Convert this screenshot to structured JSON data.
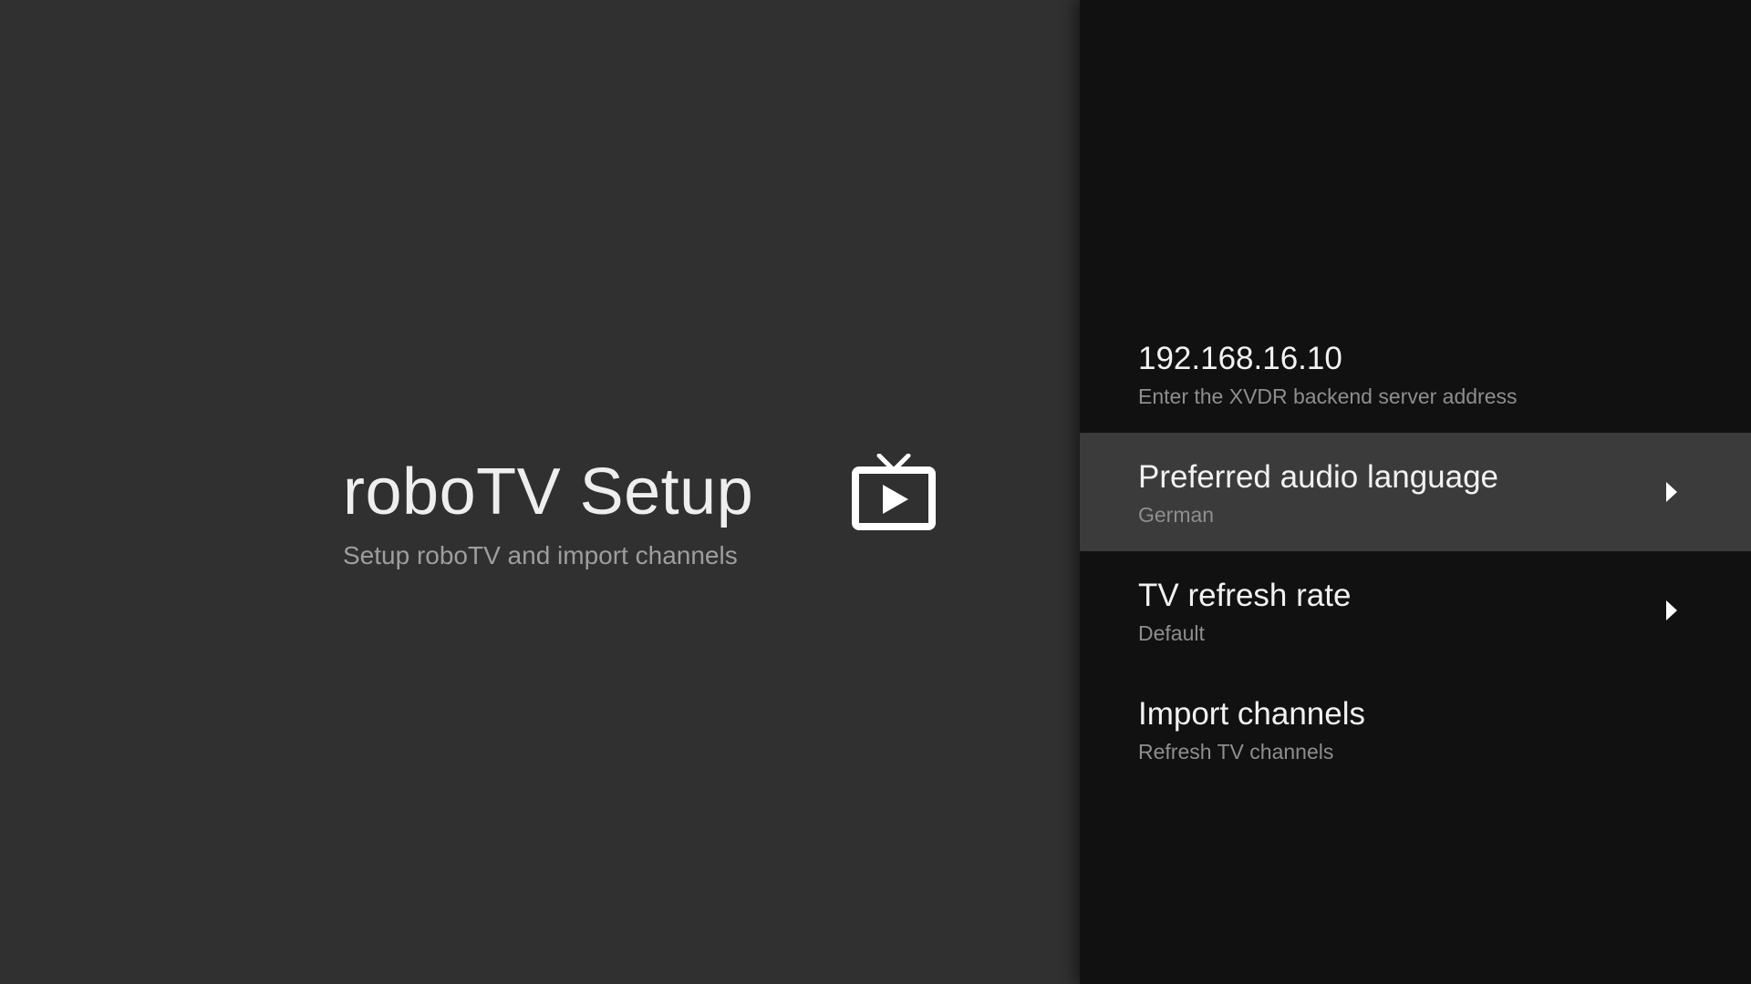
{
  "header": {
    "title": "roboTV Setup",
    "subtitle": "Setup roboTV and import channels",
    "icon": "live-tv-icon"
  },
  "settings": {
    "items": [
      {
        "title": "192.168.16.10",
        "description": "Enter the XVDR backend server address",
        "has_submenu": false,
        "focused": false
      },
      {
        "title": "Preferred audio language",
        "description": "German",
        "has_submenu": true,
        "focused": true
      },
      {
        "title": "TV refresh rate",
        "description": "Default",
        "has_submenu": true,
        "focused": false
      },
      {
        "title": "Import channels",
        "description": "Refresh TV channels",
        "has_submenu": false,
        "focused": false
      }
    ]
  },
  "colors": {
    "left_background": "#303030",
    "right_background": "#111111",
    "focused_row": "#3b3b3b",
    "primary_text": "#f2f2f2",
    "secondary_text": "#8e8e8e"
  }
}
